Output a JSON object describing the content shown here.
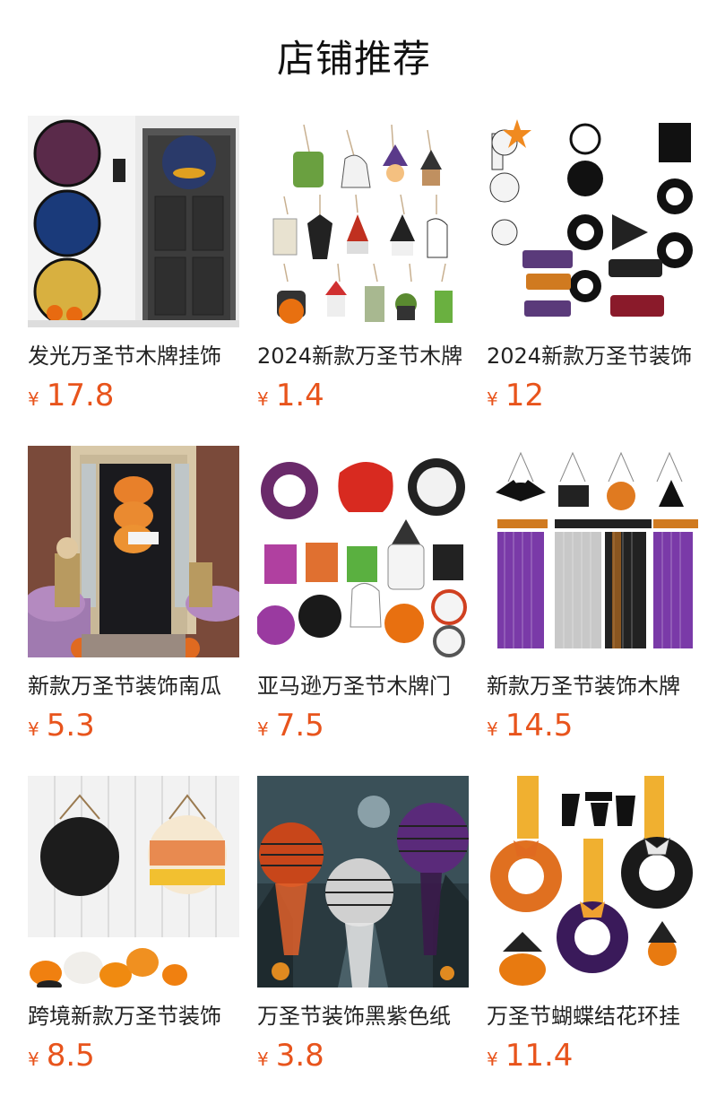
{
  "header": {
    "title": "店铺推荐"
  },
  "products": [
    {
      "name": "发光万圣节木牌挂饰",
      "currency": "¥",
      "price": "17.8",
      "image": "halloween-light-up-round-signs"
    },
    {
      "name": "2024新款万圣节木牌",
      "currency": "¥",
      "price": "1.4",
      "image": "mini-wooden-character-ornaments"
    },
    {
      "name": "2024新款万圣节装饰",
      "currency": "¥",
      "price": "12",
      "image": "boo-ghost-hanging-signs"
    },
    {
      "name": "新款万圣节装饰南瓜",
      "currency": "¥",
      "price": "5.3",
      "image": "pumpkin-boo-door-hanger"
    },
    {
      "name": "亚马逊万圣节木牌门",
      "currency": "¥",
      "price": "7.5",
      "image": "skull-boo-door-signs"
    },
    {
      "name": "新款万圣节装饰木牌",
      "currency": "¥",
      "price": "14.5",
      "image": "tinsel-curtain-hanging-signs"
    },
    {
      "name": "跨境新款万圣节装饰",
      "currency": "¥",
      "price": "8.5",
      "image": "happy-halloween-boo-round-signs"
    },
    {
      "name": "万圣节装饰黑紫色纸",
      "currency": "¥",
      "price": "3.8",
      "image": "honeycomb-paper-balls"
    },
    {
      "name": "万圣节蝴蝶结花环挂",
      "currency": "¥",
      "price": "11.4",
      "image": "bow-wreath-hangers"
    }
  ]
}
